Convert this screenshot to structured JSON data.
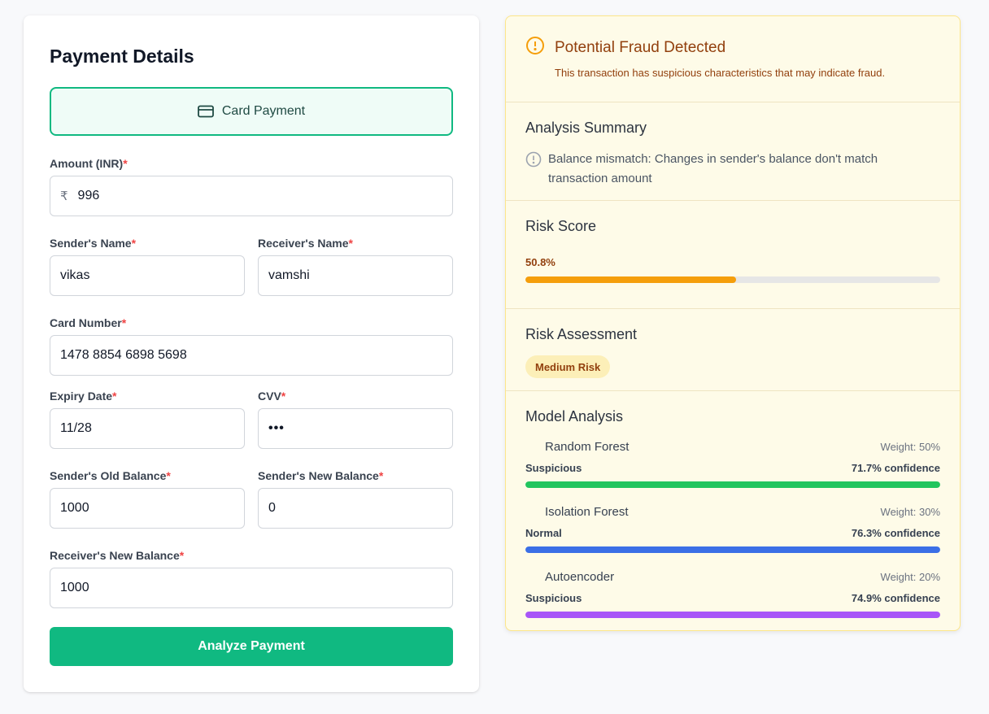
{
  "form": {
    "title": "Payment Details",
    "method_label": "Card Payment",
    "required_mark": "*",
    "fields": {
      "amount": {
        "label": "Amount (INR)",
        "prefix": "₹",
        "value": "996"
      },
      "sender_name": {
        "label": "Sender's Name",
        "value": "vikas"
      },
      "receiver_name": {
        "label": "Receiver's Name",
        "value": "vamshi"
      },
      "card_number": {
        "label": "Card Number",
        "value": "1478 8854 6898 5698"
      },
      "expiry": {
        "label": "Expiry Date",
        "value": "11/28"
      },
      "cvv": {
        "label": "CVV",
        "value": "•••"
      },
      "sender_old_balance": {
        "label": "Sender's Old Balance",
        "value": "1000"
      },
      "sender_new_balance": {
        "label": "Sender's New Balance",
        "value": "0"
      },
      "receiver_new_balance": {
        "label": "Receiver's New Balance",
        "value": "1000"
      }
    },
    "submit_label": "Analyze Payment"
  },
  "result": {
    "alert": {
      "title": "Potential Fraud Detected",
      "description": "This transaction has suspicious characteristics that may indicate fraud."
    },
    "summary": {
      "title": "Analysis Summary",
      "items": [
        "Balance mismatch: Changes in sender's balance don't match transaction amount"
      ]
    },
    "risk_score": {
      "title": "Risk Score",
      "value_text": "50.8%",
      "value": 50.8
    },
    "risk_assessment": {
      "title": "Risk Assessment",
      "badge": "Medium Risk"
    },
    "models": {
      "title": "Model Analysis",
      "items": [
        {
          "name": "Random Forest",
          "weight": "Weight: 50%",
          "verdict": "Suspicious",
          "confidence": "71.7% confidence",
          "color": "#22c55e"
        },
        {
          "name": "Isolation Forest",
          "weight": "Weight: 30%",
          "verdict": "Normal",
          "confidence": "76.3% confidence",
          "color": "#3b6fe6"
        },
        {
          "name": "Autoencoder",
          "weight": "Weight: 20%",
          "verdict": "Suspicious",
          "confidence": "74.9% confidence",
          "color": "#a855f7"
        }
      ]
    }
  },
  "colors": {
    "accent": "#10b981",
    "warning": "#92400e",
    "risk_bar": "#f59e0b"
  },
  "icons": {
    "method": "credit-card-icon",
    "alert": "alert-circle-icon",
    "summary": "info-circle-icon"
  }
}
